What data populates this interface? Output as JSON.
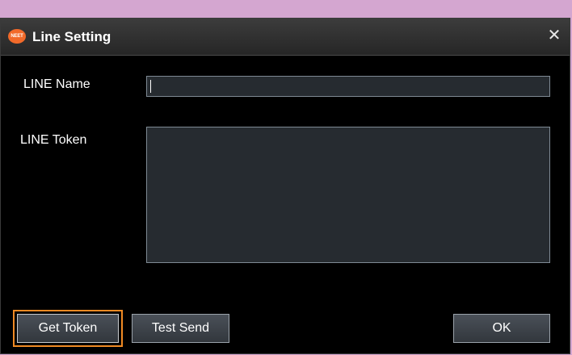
{
  "window": {
    "title": "Line Setting",
    "app_icon": "NEET",
    "close_glyph": "✕"
  },
  "form": {
    "name_label": "LINE Name",
    "name_value": "",
    "token_label": "LINE Token",
    "token_value": ""
  },
  "buttons": {
    "get_token": "Get Token",
    "test_send": "Test Send",
    "ok": "OK"
  },
  "colors": {
    "highlight_outline": "#f08a24",
    "app_icon": "#f26a2a",
    "background_strip": "#d4a6d0"
  }
}
